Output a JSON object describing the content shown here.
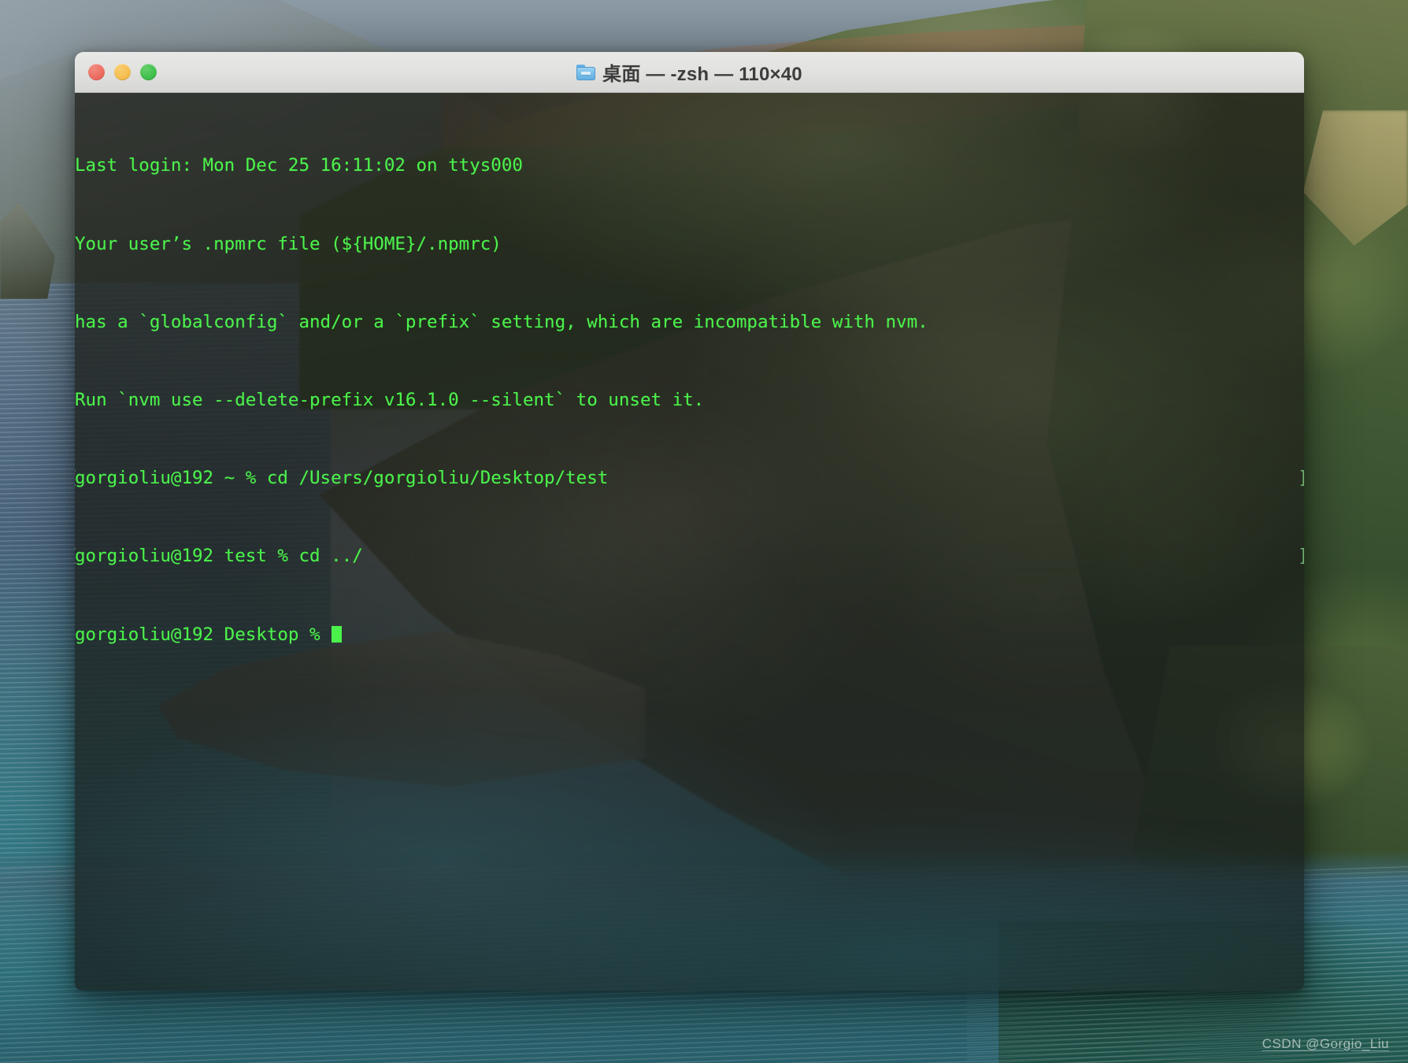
{
  "desktop": {
    "wallpaper_name": "coastal-headland-wallpaper",
    "watermark": "CSDN @Gorgio_Liu"
  },
  "window": {
    "app": "Terminal",
    "title": "桌面 — -zsh — 110×40",
    "folder_icon": "folder-icon",
    "traffic_lights": [
      {
        "name": "close-button",
        "label": "Close",
        "color": "#ED6A5E"
      },
      {
        "name": "minimize-button",
        "label": "Minimize",
        "color": "#F5BD4F"
      },
      {
        "name": "maximize-button",
        "label": "Zoom",
        "color": "#3FBF4B"
      }
    ],
    "geometry": {
      "columns": 110,
      "rows": 40
    },
    "shell": "-zsh",
    "directory": "桌面"
  },
  "terminal": {
    "foreground_color": "#4CF24C",
    "background_color": "#181A16",
    "lines": [
      {
        "bracket": false,
        "text": "Last login: Mon Dec 25 16:11:02 on ttys000"
      },
      {
        "bracket": false,
        "text": "Your user’s .npmrc file (${HOME}/.npmrc)"
      },
      {
        "bracket": false,
        "text": "has a `globalconfig` and/or a `prefix` setting, which are incompatible with nvm."
      },
      {
        "bracket": false,
        "text": "Run `nvm use --delete-prefix v16.1.0 --silent` to unset it."
      },
      {
        "bracket": true,
        "text": "gorgioliu@192 ~ % cd /Users/gorgioliu/Desktop/test"
      },
      {
        "bracket": true,
        "text": "gorgioliu@192 test % cd ../"
      },
      {
        "bracket": false,
        "text": "gorgioliu@192 Desktop % ",
        "cursor": true
      }
    ],
    "bracket_open": "[",
    "bracket_close": "]"
  }
}
